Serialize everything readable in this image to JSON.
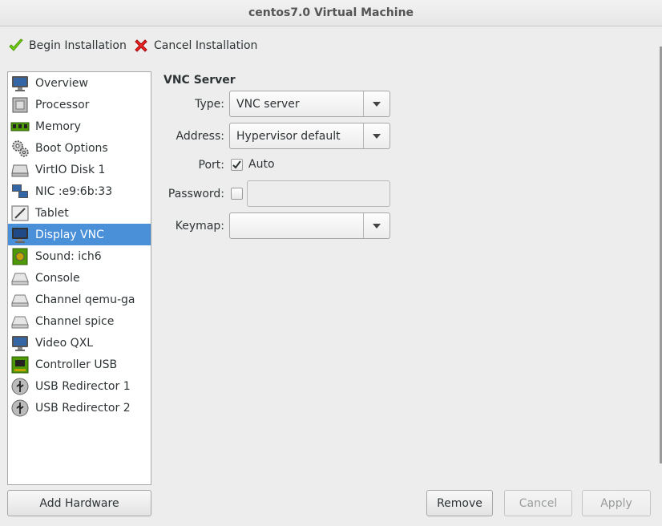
{
  "window": {
    "title": "centos7.0 Virtual Machine"
  },
  "toolbar": {
    "begin_label": "Begin Installation",
    "cancel_label": "Cancel Installation"
  },
  "sidebar": {
    "items": [
      {
        "label": "Overview",
        "icon": "monitor-icon"
      },
      {
        "label": "Processor",
        "icon": "cpu-icon"
      },
      {
        "label": "Memory",
        "icon": "memory-icon"
      },
      {
        "label": "Boot Options",
        "icon": "gears-icon"
      },
      {
        "label": "VirtIO Disk 1",
        "icon": "disk-icon"
      },
      {
        "label": "NIC :e9:6b:33",
        "icon": "network-icon"
      },
      {
        "label": "Tablet",
        "icon": "tablet-icon"
      },
      {
        "label": "Display VNC",
        "icon": "display-icon"
      },
      {
        "label": "Sound: ich6",
        "icon": "sound-card-icon"
      },
      {
        "label": "Console",
        "icon": "serial-icon"
      },
      {
        "label": "Channel qemu-ga",
        "icon": "serial-icon"
      },
      {
        "label": "Channel spice",
        "icon": "serial-icon"
      },
      {
        "label": "Video QXL",
        "icon": "video-icon"
      },
      {
        "label": "Controller USB",
        "icon": "controller-icon"
      },
      {
        "label": "USB Redirector 1",
        "icon": "usb-icon"
      },
      {
        "label": "USB Redirector 2",
        "icon": "usb-icon"
      }
    ],
    "selected_index": 7
  },
  "vnc": {
    "section_title": "VNC Server",
    "type_label": "Type:",
    "type_value": "VNC server",
    "address_label": "Address:",
    "address_value": "Hypervisor default",
    "port_label": "Port:",
    "port_auto_label": "Auto",
    "port_auto_checked": true,
    "password_label": "Password:",
    "password_checked": false,
    "password_value": "",
    "keymap_label": "Keymap:",
    "keymap_value": ""
  },
  "buttons": {
    "add_hardware": "Add Hardware",
    "remove": "Remove",
    "cancel": "Cancel",
    "apply": "Apply"
  },
  "colors": {
    "selection": "#4a90d9",
    "ok_green": "#4e9a06",
    "cancel_red": "#cc0000"
  }
}
